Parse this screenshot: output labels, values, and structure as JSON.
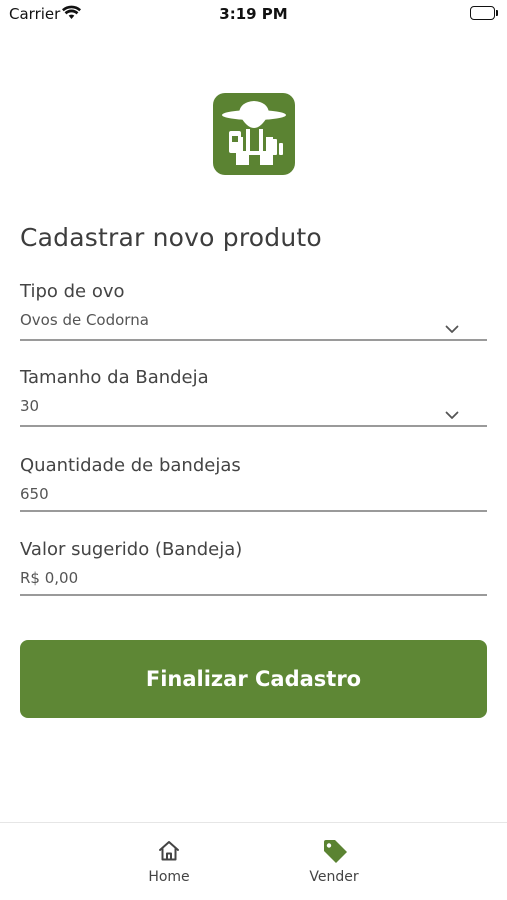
{
  "status_bar": {
    "carrier": "Carrier",
    "time": "3:19 PM"
  },
  "logo": {
    "icon": "farmer-logo-icon",
    "color": "#5b8332"
  },
  "form": {
    "title": "Cadastrar novo produto",
    "fields": [
      {
        "label": "Tipo de ovo",
        "value": "Ovos de Codorna",
        "type": "select"
      },
      {
        "label": "Tamanho da Bandeja",
        "value": "30",
        "type": "select"
      },
      {
        "label": "Quantidade de bandejas",
        "value": "650",
        "type": "input"
      },
      {
        "label": "Valor sugerido (Bandeja)",
        "value": "R$ 0,00",
        "type": "input"
      }
    ],
    "submit_label": "Finalizar Cadastro",
    "accent_color": "#5e8735"
  },
  "tab_bar": {
    "items": [
      {
        "label": "Home",
        "icon": "home-icon",
        "active": false
      },
      {
        "label": "Vender",
        "icon": "tag-icon",
        "active": true,
        "color": "#5b8332"
      }
    ]
  }
}
